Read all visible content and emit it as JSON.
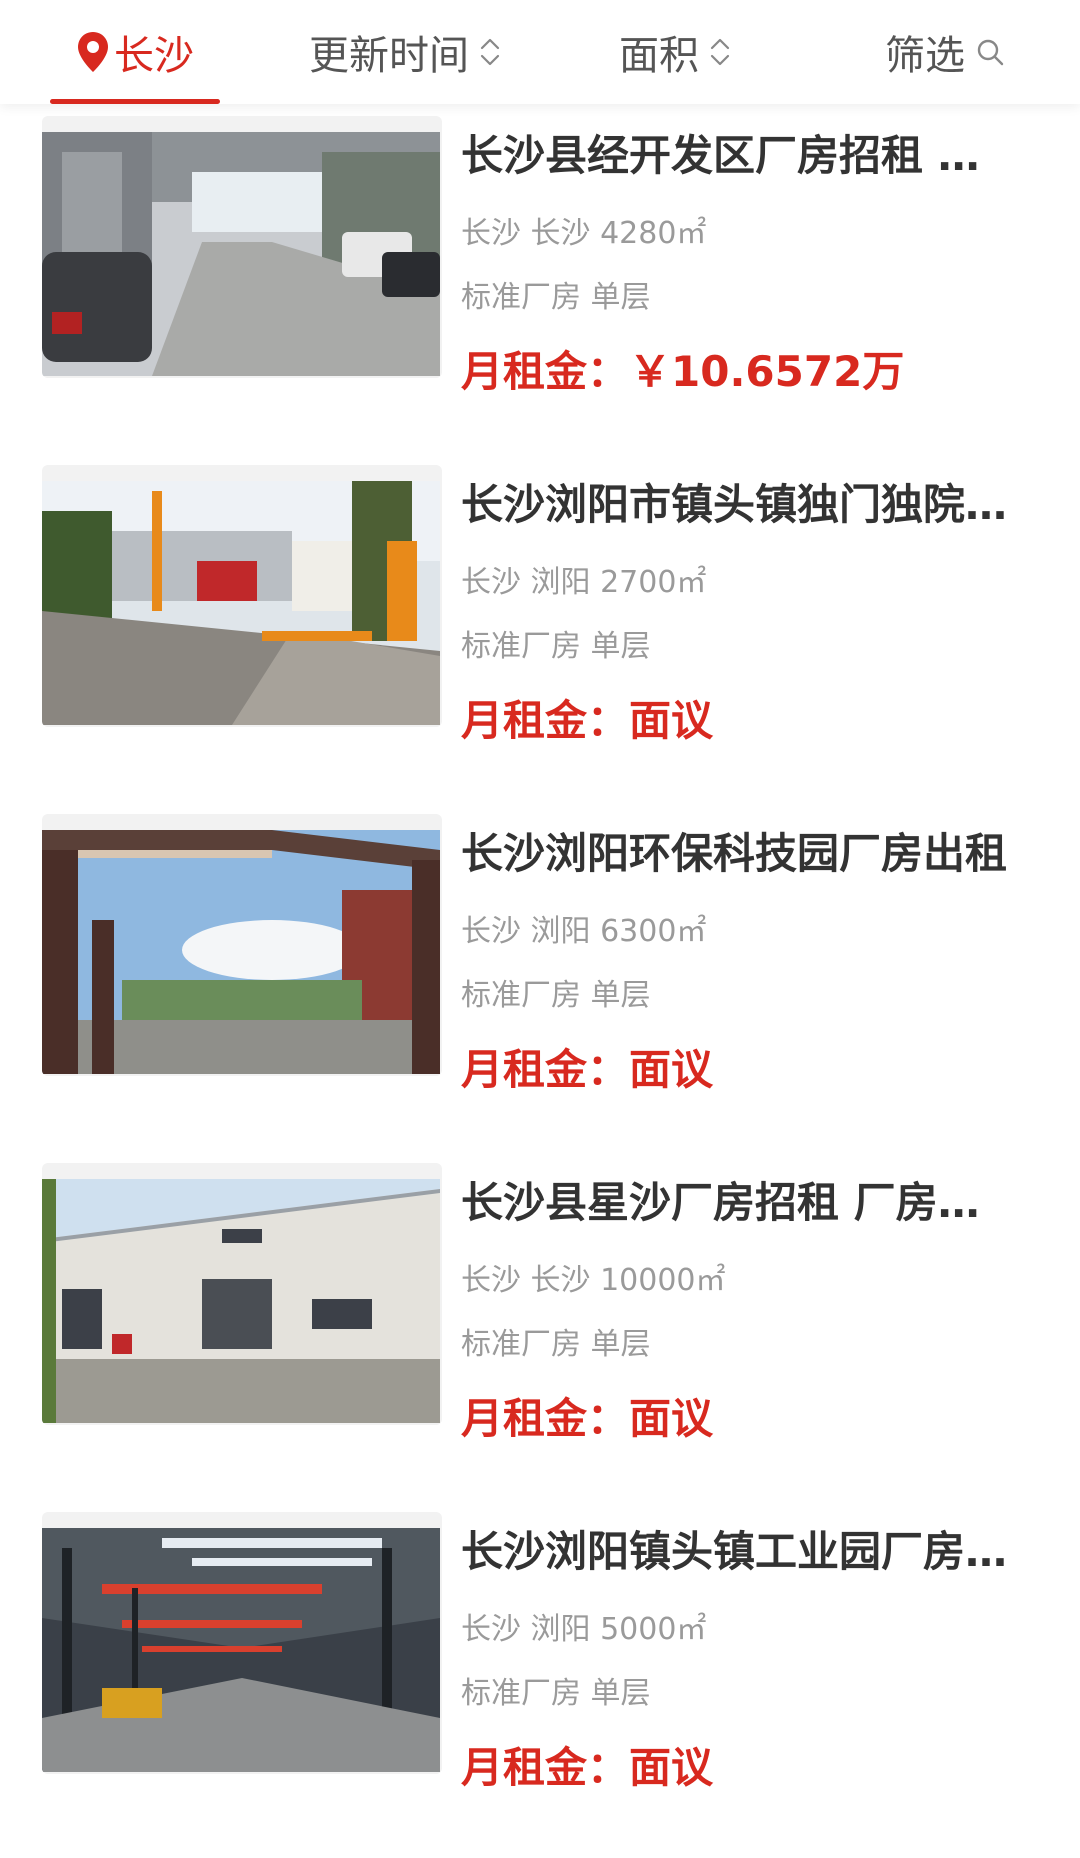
{
  "filter_bar": {
    "city": "长沙",
    "sort_update": "更新时间",
    "sort_area": "面积",
    "filter": "筛选"
  },
  "colors": {
    "accent": "#d8291f",
    "title": "#333333",
    "meta": "#9a9a9a"
  },
  "listings": [
    {
      "title": "长沙县经开发区厂房招租 厂房出租",
      "location": "长沙 长沙 4280㎡",
      "type": "标准厂房 单层",
      "price_label": "月租金：",
      "price_value": "￥10.6572万"
    },
    {
      "title": "长沙浏阳市镇头镇独门独院厂房",
      "location": "长沙 浏阳 2700㎡",
      "type": "标准厂房 单层",
      "price_label": "月租金：",
      "price_value": "面议"
    },
    {
      "title": "长沙浏阳环保科技园厂房出租",
      "location": "长沙 浏阳 6300㎡",
      "type": "标准厂房 单层",
      "price_label": "月租金：",
      "price_value": "面议"
    },
    {
      "title": "长沙县星沙厂房招租 厂房出租",
      "location": "长沙 长沙 10000㎡",
      "type": "标准厂房 单层",
      "price_label": "月租金：",
      "price_value": "面议"
    },
    {
      "title": "长沙浏阳镇头镇工业园厂房出租",
      "location": "长沙 浏阳 5000㎡",
      "type": "标准厂房 单层",
      "price_label": "月租金：",
      "price_value": "面议"
    }
  ]
}
